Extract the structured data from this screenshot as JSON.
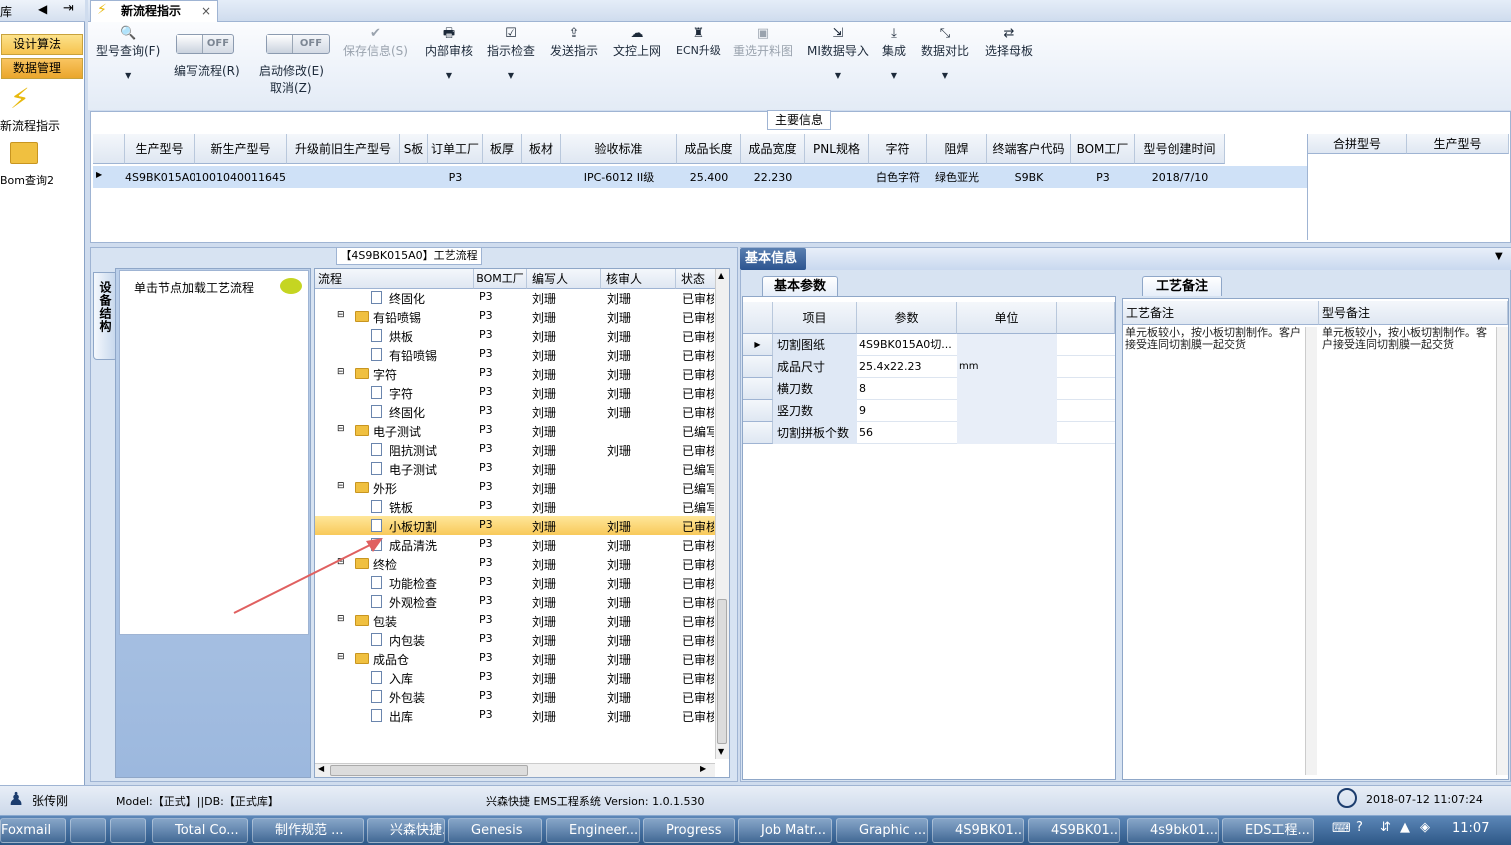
{
  "left_panel": {
    "title": "库",
    "buttons": [
      "设计算法",
      "数据管理"
    ],
    "items": [
      {
        "icon": "lightning-icon",
        "label": "新流程指示"
      },
      {
        "icon": "folder-open-icon",
        "label": "Bom查询2"
      }
    ]
  },
  "doc_tab": {
    "label": "新流程指示"
  },
  "ribbon": {
    "model_query": "型号查询(F)",
    "toggle_off": "OFF",
    "write_flow": "编写流程(R)",
    "start_modify": "启动修改(E)",
    "cancel": "取消(Z)",
    "save_info": "保存信息(S)",
    "internal_review": "内部审核",
    "instruction_check": "指示检查",
    "send_instruction": "发送指示",
    "upload": "文控上网",
    "ecn_upgrade": "ECN升级",
    "reselect_map": "重选开料图",
    "mi_import": "MI数据导入",
    "integrate": "集成",
    "data_compare": "数据对比",
    "select_master": "选择母板"
  },
  "main_info": {
    "title": "主要信息",
    "columns": [
      "生产型号",
      "新生产型号",
      "升级前旧生产型号",
      "S板",
      "订单工厂",
      "板厚",
      "板材",
      "验收标准",
      "成品长度",
      "成品宽度",
      "PNL规格",
      "字符",
      "阻焊",
      "终端客户代码",
      "BOM工厂",
      "型号创建时间"
    ],
    "row": [
      "4S9BK015A0",
      "10010400116457",
      "",
      "",
      "P3",
      "",
      "",
      "IPC-6012 II级",
      "25.400",
      "22.230",
      "",
      "白色字符",
      "绿色亚光",
      "S9BK",
      "P3",
      "2018/7/10"
    ],
    "side_columns": [
      "合拼型号",
      "生产型号"
    ]
  },
  "process": {
    "title": "【4S9BK015A0】工艺流程",
    "vertical_tab": "设备结构",
    "hint": "单击节点加载工艺流程",
    "columns": [
      "流程",
      "BOM工厂",
      "编写人",
      "核审人",
      "状态"
    ],
    "rows": [
      {
        "level": 2,
        "type": "page",
        "name": "终固化",
        "bom": "P3",
        "writer": "刘珊",
        "reviewer": "刘珊",
        "status": "已审核"
      },
      {
        "level": 1,
        "type": "folder",
        "name": "有铅喷锡",
        "bom": "P3",
        "writer": "刘珊",
        "reviewer": "刘珊",
        "status": "已审核"
      },
      {
        "level": 2,
        "type": "page",
        "name": "烘板",
        "bom": "P3",
        "writer": "刘珊",
        "reviewer": "刘珊",
        "status": "已审核"
      },
      {
        "level": 2,
        "type": "page",
        "name": "有铅喷锡",
        "bom": "P3",
        "writer": "刘珊",
        "reviewer": "刘珊",
        "status": "已审核"
      },
      {
        "level": 1,
        "type": "folder",
        "name": "字符",
        "bom": "P3",
        "writer": "刘珊",
        "reviewer": "刘珊",
        "status": "已审核"
      },
      {
        "level": 2,
        "type": "page",
        "name": "字符",
        "bom": "P3",
        "writer": "刘珊",
        "reviewer": "刘珊",
        "status": "已审核"
      },
      {
        "level": 2,
        "type": "page",
        "name": "终固化",
        "bom": "P3",
        "writer": "刘珊",
        "reviewer": "刘珊",
        "status": "已审核"
      },
      {
        "level": 1,
        "type": "folder",
        "name": "电子测试",
        "bom": "P3",
        "writer": "刘珊",
        "reviewer": "",
        "status": "已编写"
      },
      {
        "level": 2,
        "type": "page",
        "name": "阻抗测试",
        "bom": "P3",
        "writer": "刘珊",
        "reviewer": "刘珊",
        "status": "已审核"
      },
      {
        "level": 2,
        "type": "page",
        "name": "电子测试",
        "bom": "P3",
        "writer": "刘珊",
        "reviewer": "",
        "status": "已编写"
      },
      {
        "level": 1,
        "type": "folder",
        "name": "外形",
        "bom": "P3",
        "writer": "刘珊",
        "reviewer": "",
        "status": "已编写"
      },
      {
        "level": 2,
        "type": "page",
        "name": "铣板",
        "bom": "P3",
        "writer": "刘珊",
        "reviewer": "",
        "status": "已编写"
      },
      {
        "level": 2,
        "type": "page",
        "name": "小板切割",
        "bom": "P3",
        "writer": "刘珊",
        "reviewer": "刘珊",
        "status": "已审核",
        "selected": true
      },
      {
        "level": 2,
        "type": "page",
        "name": "成品清洗",
        "bom": "P3",
        "writer": "刘珊",
        "reviewer": "刘珊",
        "status": "已审核"
      },
      {
        "level": 1,
        "type": "folder",
        "name": "终检",
        "bom": "P3",
        "writer": "刘珊",
        "reviewer": "刘珊",
        "status": "已审核"
      },
      {
        "level": 2,
        "type": "page",
        "name": "功能检查",
        "bom": "P3",
        "writer": "刘珊",
        "reviewer": "刘珊",
        "status": "已审核"
      },
      {
        "level": 2,
        "type": "page",
        "name": "外观检查",
        "bom": "P3",
        "writer": "刘珊",
        "reviewer": "刘珊",
        "status": "已审核"
      },
      {
        "level": 1,
        "type": "folder",
        "name": "包装",
        "bom": "P3",
        "writer": "刘珊",
        "reviewer": "刘珊",
        "status": "已审核"
      },
      {
        "level": 2,
        "type": "page",
        "name": "内包装",
        "bom": "P3",
        "writer": "刘珊",
        "reviewer": "刘珊",
        "status": "已审核"
      },
      {
        "level": 1,
        "type": "folder",
        "name": "成品仓",
        "bom": "P3",
        "writer": "刘珊",
        "reviewer": "刘珊",
        "status": "已审核"
      },
      {
        "level": 2,
        "type": "page",
        "name": "入库",
        "bom": "P3",
        "writer": "刘珊",
        "reviewer": "刘珊",
        "status": "已审核"
      },
      {
        "level": 2,
        "type": "page",
        "name": "外包装",
        "bom": "P3",
        "writer": "刘珊",
        "reviewer": "刘珊",
        "status": "已审核"
      },
      {
        "level": 2,
        "type": "page",
        "name": "出库",
        "bom": "P3",
        "writer": "刘珊",
        "reviewer": "刘珊",
        "status": "已审核"
      }
    ]
  },
  "basic_info": {
    "header": "基本信息",
    "tab": "基本参数",
    "columns": [
      "项目",
      "参数",
      "单位"
    ],
    "rows": [
      {
        "item": "切割图纸",
        "param": "4S9BK015A0切...",
        "unit": ""
      },
      {
        "item": "成品尺寸",
        "param": "25.4x22.23",
        "unit": "mm"
      },
      {
        "item": "横刀数",
        "param": "8",
        "unit": ""
      },
      {
        "item": "竖刀数",
        "param": "9",
        "unit": ""
      },
      {
        "item": "切割拼板个数",
        "param": "56",
        "unit": ""
      }
    ]
  },
  "remarks": {
    "tab": "工艺备注",
    "col1": "工艺备注",
    "col2": "型号备注",
    "text1": "单元板较小，按小板切割制作。客户接受连同切割膜一起交货",
    "text2": "单元板较小，按小板切割制作。客户接受连同切割膜一起交货"
  },
  "status_bar": {
    "user": "张传刚",
    "model": "Model:【正式】||DB:【正式库】",
    "system": "兴森快捷 EMS工程系统 Version: 1.0.1.530",
    "datetime": "2018-07-12 11:07:24"
  },
  "taskbar": {
    "items": [
      "Foxmail",
      "",
      "",
      "Total Co...",
      "制作规范 ...",
      "兴森快捷...",
      "Genesis",
      "Engineer...",
      "Progress",
      "Job Matr...",
      "Graphic ...",
      "4S9BK01...",
      "4S9BK01...",
      "4s9bk01...",
      "EDS工程..."
    ],
    "clock": "11:07"
  }
}
